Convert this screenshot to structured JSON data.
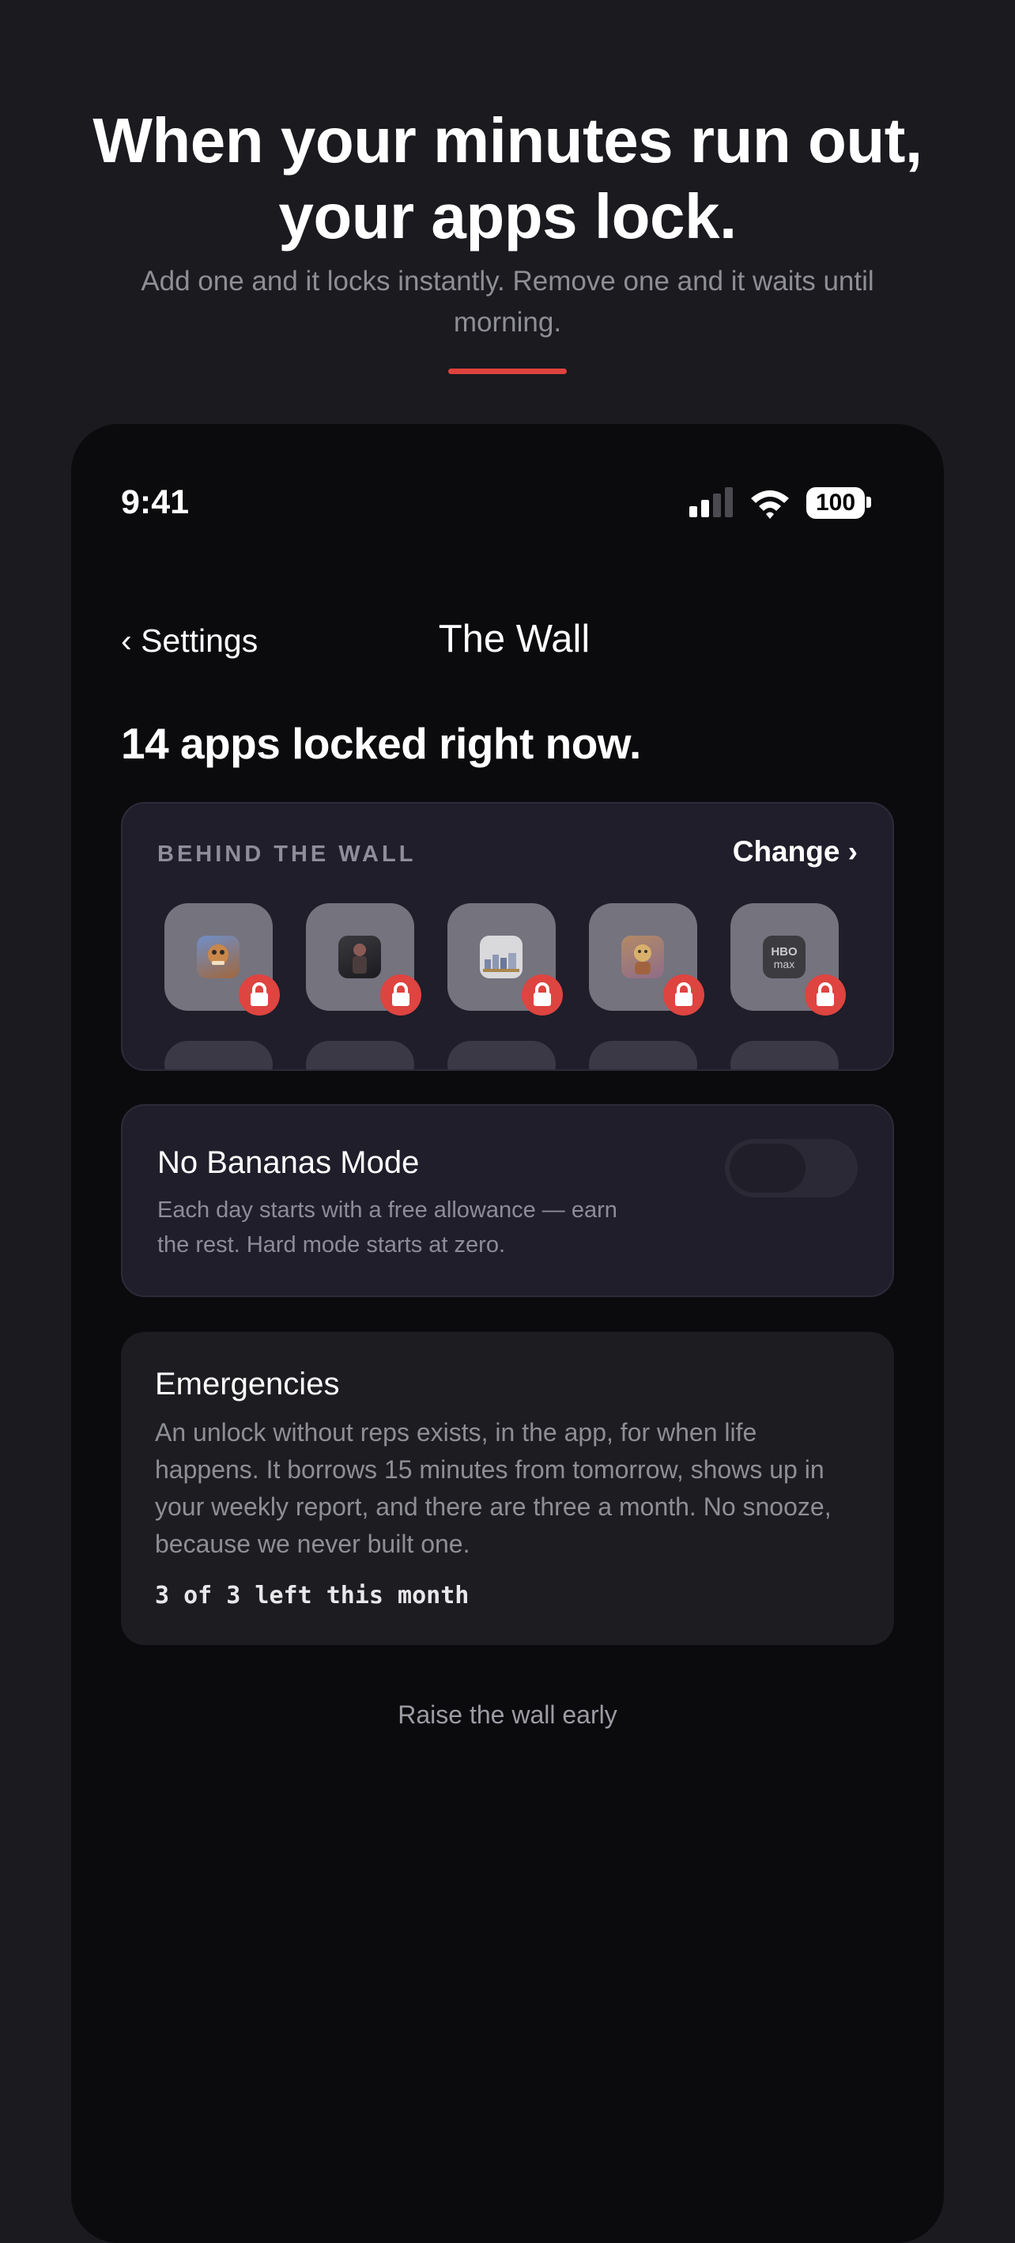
{
  "hero": {
    "headline_line1": "When your minutes run out,",
    "headline_line2": "your apps lock.",
    "subtitle": "Add one and it locks instantly. Remove one and it waits until morning.",
    "accent_color": "#e0423e"
  },
  "status_bar": {
    "time": "9:41",
    "battery": "100",
    "signal_bars_active": 2,
    "icons": [
      "cellular-signal-icon",
      "wifi-icon",
      "battery-icon"
    ]
  },
  "nav": {
    "back_chevron": "‹",
    "back_label": "Settings",
    "title": "The Wall"
  },
  "locked_summary": "14 apps locked right now.",
  "wall_card": {
    "label": "BEHIND THE WALL",
    "change_label": "Change ›",
    "apps": [
      {
        "icon": "crash-bandicoot-app-icon",
        "locked": true
      },
      {
        "icon": "dark-game-app-icon",
        "locked": true
      },
      {
        "icon": "city-game-app-icon",
        "locked": true
      },
      {
        "icon": "cartoon-game-app-icon",
        "locked": true
      },
      {
        "icon": "hbo-max-app-icon",
        "label": "HBO max",
        "locked": true
      }
    ],
    "lock_badge_icon": "padlock-icon",
    "lock_badge_color": "#de4440"
  },
  "bananas_card": {
    "title": "No Bananas Mode",
    "description_line1": "Each day starts with a free allowance — earn",
    "description_line2": "the rest. Hard mode starts at zero.",
    "toggle_on": false
  },
  "emergencies_card": {
    "title": "Emergencies",
    "description": "An unlock without reps exists, in the app, for when life happens. It borrows 15 minutes from tomorrow, shows up in your weekly report, and there are three a month. No snooze, because we never built one.",
    "count": "3 of 3 left this month"
  },
  "raise_wall_label": "Raise the wall early"
}
